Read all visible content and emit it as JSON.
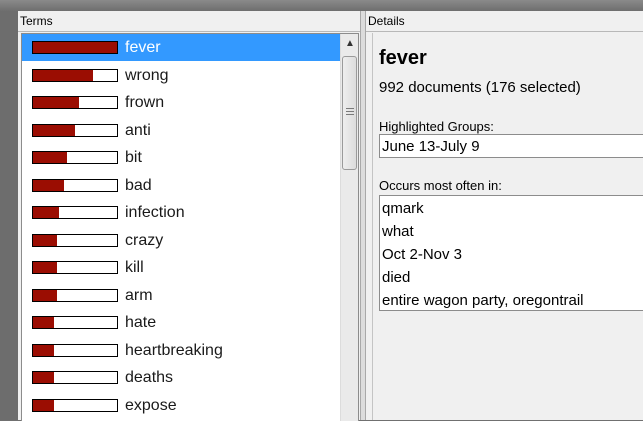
{
  "terms_panel": {
    "header": "Terms",
    "items": [
      {
        "label": "fever",
        "score": 1.0
      },
      {
        "label": "wrong",
        "score": 0.72
      },
      {
        "label": "frown",
        "score": 0.55
      },
      {
        "label": "anti",
        "score": 0.5
      },
      {
        "label": "bit",
        "score": 0.4
      },
      {
        "label": "bad",
        "score": 0.37
      },
      {
        "label": "infection",
        "score": 0.31
      },
      {
        "label": "crazy",
        "score": 0.29
      },
      {
        "label": "kill",
        "score": 0.28
      },
      {
        "label": "arm",
        "score": 0.28
      },
      {
        "label": "hate",
        "score": 0.25
      },
      {
        "label": "heartbreaking",
        "score": 0.25
      },
      {
        "label": "deaths",
        "score": 0.25
      },
      {
        "label": "expose",
        "score": 0.25
      }
    ],
    "selected_index": 0,
    "bar_color": "#9b0d02",
    "selected_color": "#3399ff"
  },
  "details_panel": {
    "header": "Details",
    "term": "fever",
    "doc_count": "992 documents (176 selected)",
    "highlighted_groups_label": "Highlighted Groups:",
    "highlighted_groups": [
      "June 13-July 9"
    ],
    "occurs_label": "Occurs most often in:",
    "occurs": [
      "qmark",
      "what",
      "Oct 2-Nov 3",
      "died",
      "entire wagon party, oregontrail"
    ]
  },
  "icons": {
    "scroll_up": "▲"
  }
}
